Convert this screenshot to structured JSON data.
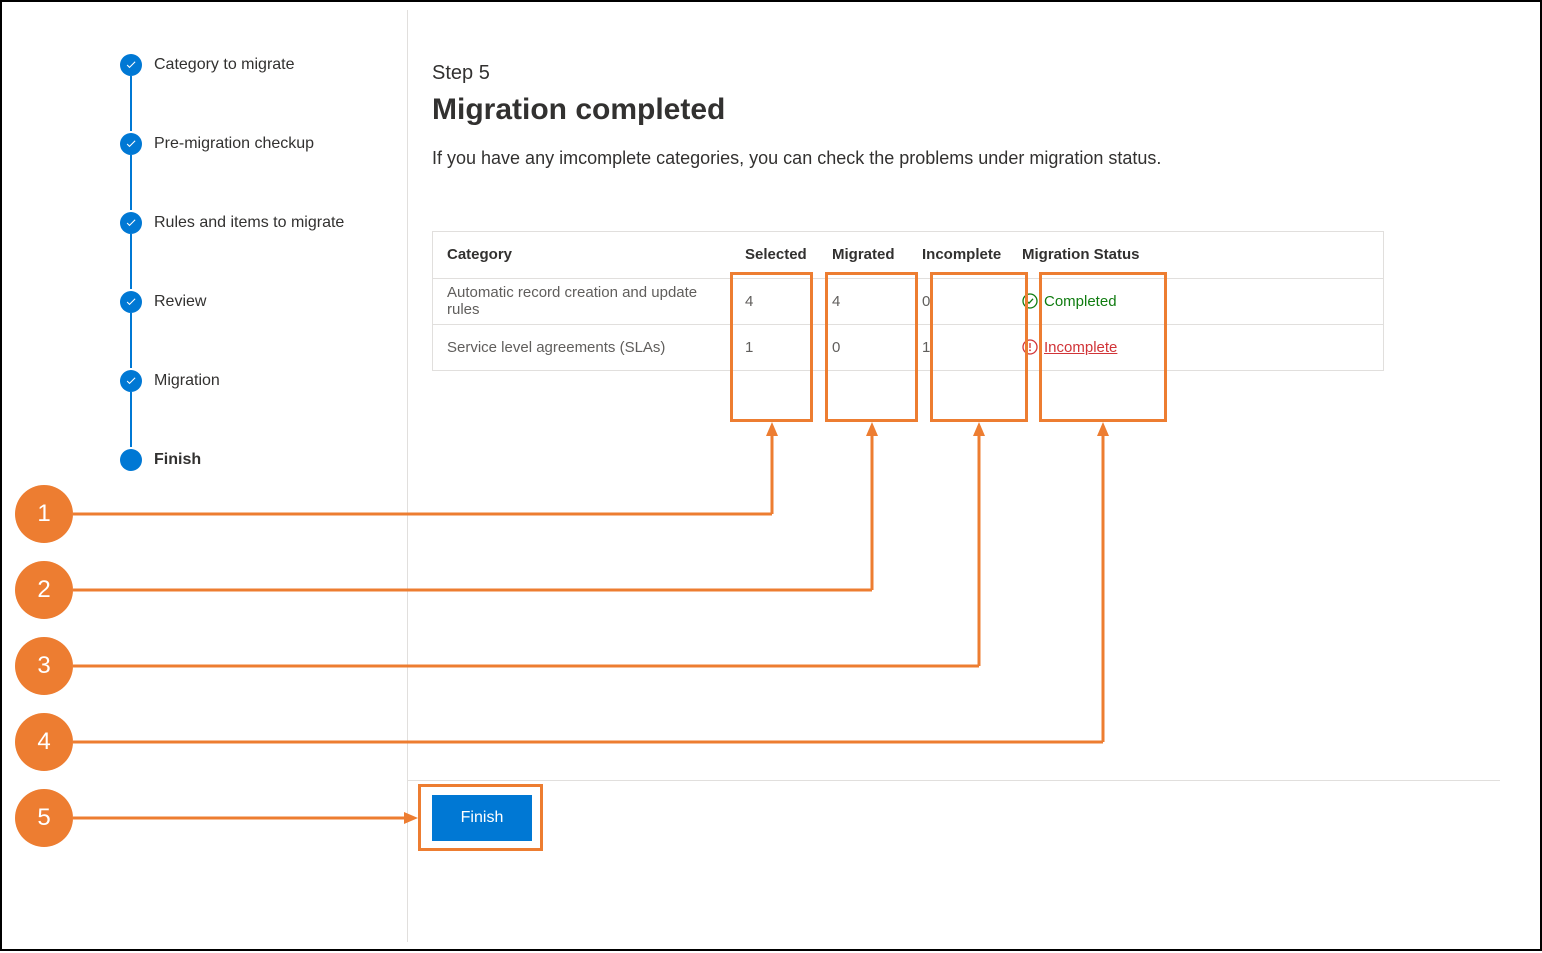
{
  "wizard": {
    "steps": [
      {
        "label": "Category to migrate",
        "state": "done"
      },
      {
        "label": "Pre-migration checkup",
        "state": "done"
      },
      {
        "label": "Rules and items to migrate",
        "state": "done"
      },
      {
        "label": "Review",
        "state": "done"
      },
      {
        "label": "Migration",
        "state": "done"
      },
      {
        "label": "Finish",
        "state": "current"
      }
    ]
  },
  "main": {
    "step_label": "Step 5",
    "title": "Migration completed",
    "description": "If you have any imcomplete categories, you can check the problems under migration status."
  },
  "table": {
    "headers": {
      "category": "Category",
      "selected": "Selected",
      "migrated": "Migrated",
      "incomplete": "Incomplete",
      "status": "Migration Status"
    },
    "rows": [
      {
        "category": "Automatic record creation and update rules",
        "selected": "4",
        "migrated": "4",
        "incomplete": "0",
        "status_text": "Completed",
        "status_kind": "completed"
      },
      {
        "category": "Service level agreements (SLAs)",
        "selected": "1",
        "migrated": "0",
        "incomplete": "1",
        "status_text": "Incomplete",
        "status_kind": "incomplete"
      }
    ]
  },
  "footer": {
    "finish_label": "Finish"
  },
  "callouts": {
    "b1": "1",
    "b2": "2",
    "b3": "3",
    "b4": "4",
    "b5": "5"
  },
  "colors": {
    "accent": "#0078d4",
    "annotation": "#ed7d31",
    "success": "#107c10",
    "error": "#d13438"
  }
}
